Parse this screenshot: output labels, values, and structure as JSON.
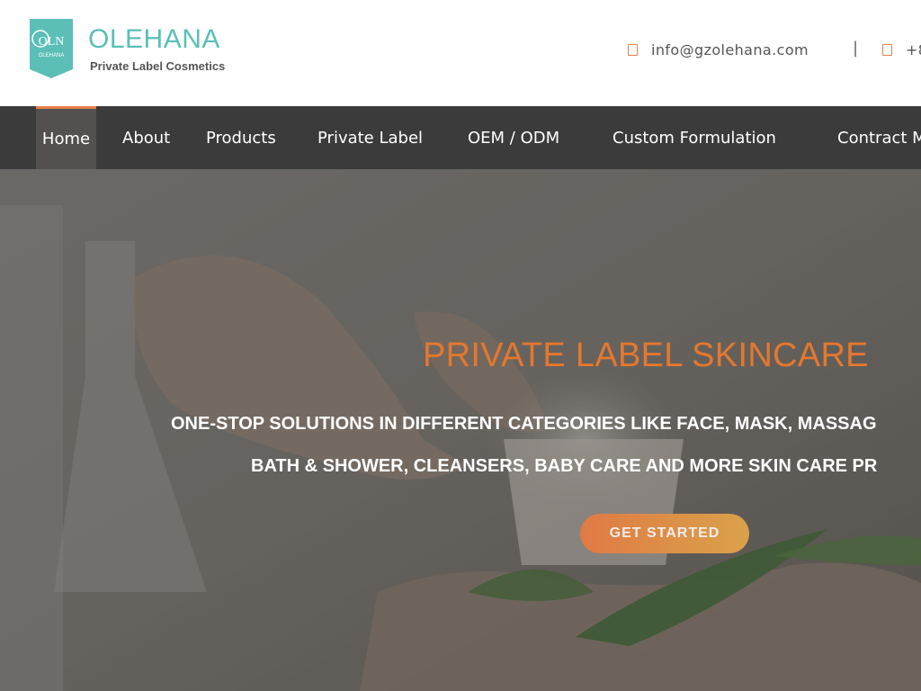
{
  "brand": {
    "name": "OLEHANA",
    "tagline": "Private Label Cosmetics",
    "logo_text": "OLN",
    "logo_subtext": "OLEHANA",
    "logo_color": "#5bbfb7"
  },
  "contact": {
    "email": "info@gzolehana.com",
    "email_icon": "envelope-icon",
    "divider": "|",
    "phone": "+8",
    "phone_icon": "phone-icon",
    "icon_color": "#e9804a"
  },
  "nav": {
    "items": [
      {
        "label": "Home",
        "active": true
      },
      {
        "label": "About"
      },
      {
        "label": "Products"
      },
      {
        "label": "Private Label"
      },
      {
        "label": "OEM / ODM"
      },
      {
        "label": "Custom Formulation"
      },
      {
        "label": "Contract M"
      }
    ],
    "active_color": "#e9804a",
    "background": "#3b3b3b"
  },
  "hero": {
    "title": "PRIVATE LABEL SKINCARE",
    "line1": "ONE-STOP SOLUTIONS IN DIFFERENT CATEGORIES LIKE FACE, MASK, MASSAG",
    "line2": "BATH & SHOWER, CLEANSERS, BABY CARE AND MORE SKIN CARE PR",
    "cta_label": "GET STARTED",
    "title_color": "#e4782e"
  }
}
